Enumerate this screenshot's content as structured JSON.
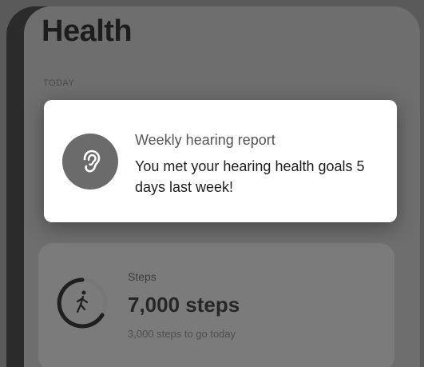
{
  "app": {
    "title": "Health",
    "section": "TODAY"
  },
  "notification": {
    "icon": "ear-icon",
    "title": "Weekly hearing report",
    "body": "You met your hearing health goals 5 days last week!"
  },
  "steps_card": {
    "icon": "walking-person-icon",
    "title": "Steps",
    "value": "7,000 steps",
    "subtitle": "3,000 steps to go today"
  }
}
